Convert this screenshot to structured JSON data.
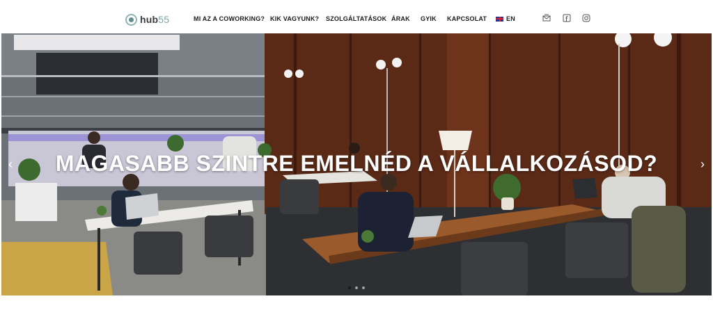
{
  "header": {
    "logo": {
      "text_bold": "hub",
      "text_num": "55"
    },
    "nav": [
      {
        "label": "MI AZ A COWORKING?"
      },
      {
        "label": "KIK VAGYUNK?"
      },
      {
        "label": "SZOLGÁLTATÁSOK"
      },
      {
        "label": "ÁRAK"
      },
      {
        "label": "GYIK"
      },
      {
        "label": "KAPCSOLAT"
      }
    ],
    "language": {
      "label": "EN",
      "flag": "uk-flag-icon"
    },
    "social": [
      "mail-icon",
      "facebook-icon",
      "instagram-icon"
    ]
  },
  "hero": {
    "title": "MAGASABB SZINTRE EMELNÉD A VÁLLALKOZÁSOD?",
    "prev_arrow": "‹",
    "next_arrow": "›",
    "slides": 3,
    "active_slide": 1
  },
  "colors": {
    "nav_text": "#1b1b1b",
    "logo_accent": "#7aa5a5",
    "hero_title": "#ffffff"
  }
}
